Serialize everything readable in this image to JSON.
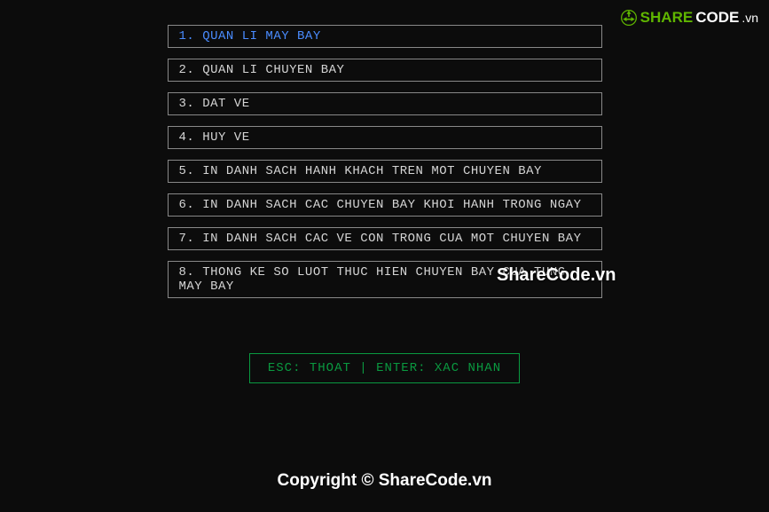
{
  "menu": {
    "items": [
      {
        "label": "1. QUAN LI MAY BAY",
        "selected": true
      },
      {
        "label": "2. QUAN LI CHUYEN BAY",
        "selected": false
      },
      {
        "label": "3. DAT VE",
        "selected": false
      },
      {
        "label": "4. HUY VE",
        "selected": false
      },
      {
        "label": "5. IN DANH SACH HANH KHACH TREN MOT CHUYEN BAY",
        "selected": false
      },
      {
        "label": "6. IN DANH SACH CAC CHUYEN BAY KHOI HANH TRONG NGAY",
        "selected": false
      },
      {
        "label": "7. IN DANH SACH CAC VE CON TRONG CUA MOT CHUYEN BAY",
        "selected": false
      },
      {
        "label": "8. THONG KE SO LUOT THUC HIEN CHUYEN BAY CUA TUNG MAY BAY",
        "selected": false
      }
    ]
  },
  "footer": {
    "label": "ESC: THOAT | ENTER: XAC NHAN"
  },
  "logo": {
    "share": "SHARE",
    "code": "CODE",
    "vn": ".vn"
  },
  "watermark": "ShareCode.vn",
  "copyright": "Copyright © ShareCode.vn"
}
